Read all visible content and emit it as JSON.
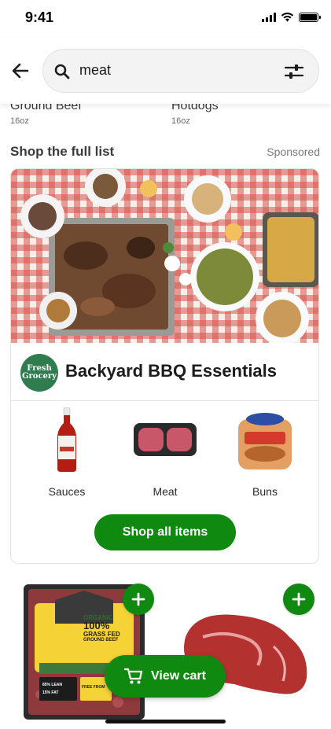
{
  "status_bar": {
    "time": "9:41"
  },
  "search": {
    "query": "meat"
  },
  "previous_results": [
    {
      "name": "Ground Beef",
      "size": "16oz"
    },
    {
      "name": "Hotdogs",
      "size": "16oz"
    }
  ],
  "section": {
    "title": "Shop the full list",
    "sponsored_label": "Sponsored"
  },
  "promo_card": {
    "brand_logo_lines": [
      "Fresh",
      "Grocery"
    ],
    "title": "Backyard BBQ Essentials",
    "categories": [
      {
        "label": "Sauces"
      },
      {
        "label": "Meat"
      },
      {
        "label": "Buns"
      }
    ],
    "shop_button": "Shop all items"
  },
  "products": [
    {
      "package_lines": [
        "100%",
        "GRASS FED",
        "GROUND BEEF"
      ],
      "brand": "SUNFED",
      "badge": "ORGANIC",
      "lean": "85% LEAN",
      "fat": "15% FAT",
      "free_from": "FREE FROM"
    },
    {
      "name": ""
    }
  ],
  "cart": {
    "label": "View cart"
  },
  "colors": {
    "accent_green": "#108910",
    "brand_green": "#2f7d4f"
  }
}
